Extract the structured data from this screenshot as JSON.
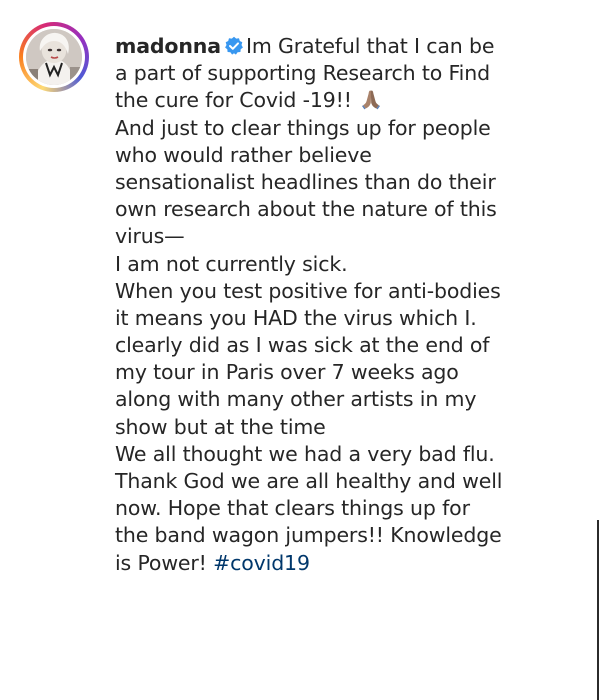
{
  "post": {
    "username": "madonna",
    "verified_icon": "verified-badge-icon",
    "avatar_icon": "profile-avatar",
    "lines": [
      "Im Grateful that I can be",
      "a part of supporting Research to Find",
      "the cure for Covid -19!!",
      "And just to clear things up for people",
      "who would rather believe",
      "sensationalist headlines than do their",
      "own research about the nature of this",
      "virus—",
      "I am not currently sick.",
      "When you test positive for anti-bodies",
      "it means you HAD the virus which I.",
      "clearly did as I was sick at the end of",
      "my tour in Paris over 7 weeks ago",
      "along with many other artists in my",
      "show but at the time",
      "We all thought we had a very bad flu.",
      "Thank God we are all healthy and well",
      "now. Hope that clears things up for",
      "the band wagon jumpers!! Knowledge",
      "is Power!"
    ],
    "hashtag": "#covid19",
    "emoji": "folded-hands-emoji"
  },
  "colors": {
    "text": "#262626",
    "hashtag": "#00376b",
    "verified": "#3897f0"
  }
}
